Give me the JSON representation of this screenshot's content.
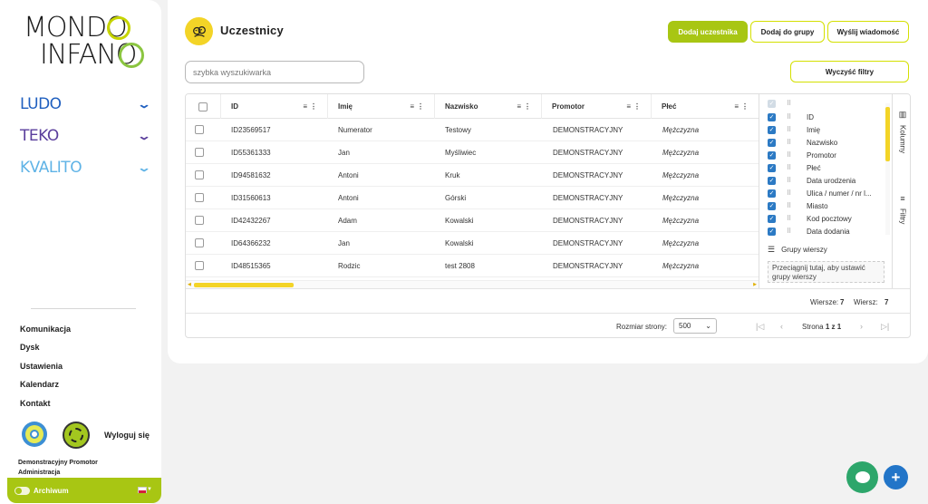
{
  "brand": {
    "line1": "MONDO",
    "line2": "INFANO"
  },
  "nav": [
    {
      "label": "LUDO",
      "color": "#1f5fbf"
    },
    {
      "label": "TEKO",
      "color": "#5a3e9c"
    },
    {
      "label": "KVALITO",
      "color": "#5fb3e6"
    }
  ],
  "menu": [
    "Komunikacja",
    "Dysk",
    "Ustawienia",
    "Kalendarz",
    "Kontakt"
  ],
  "user": {
    "logout": "Wyloguj się",
    "name": "Demonstracyjny Promotor",
    "role": "Administracja"
  },
  "archive": {
    "label": "Archiwum"
  },
  "page": {
    "title": "Uczestnicy"
  },
  "actions": {
    "add_participant": "Dodaj uczestnika",
    "add_to_group": "Dodaj do grupy",
    "send_message": "Wyślij wiadomość",
    "clear_filters": "Wyczyść filtry"
  },
  "search": {
    "placeholder": "szybka wyszukiwarka",
    "value": ""
  },
  "table": {
    "columns": [
      "ID",
      "Imię",
      "Nazwisko",
      "Promotor",
      "Płeć"
    ],
    "rows": [
      [
        "ID23569517",
        "Numerator",
        "Testowy",
        "DEMONSTRACYJNY",
        "Mężczyzna"
      ],
      [
        "ID55361333",
        "Jan",
        "Myśliwiec",
        "DEMONSTRACYJNY",
        "Mężczyzna"
      ],
      [
        "ID94581632",
        "Antoni",
        "Kruk",
        "DEMONSTRACYJNY",
        "Mężczyzna"
      ],
      [
        "ID31560613",
        "Antoni",
        "Górski",
        "DEMONSTRACYJNY",
        "Mężczyzna"
      ],
      [
        "ID42432267",
        "Adam",
        "Kowalski",
        "DEMONSTRACYJNY",
        "Mężczyzna"
      ],
      [
        "ID64366232",
        "Jan",
        "Kowalski",
        "DEMONSTRACYJNY",
        "Mężczyzna"
      ],
      [
        "ID48515365",
        "Rodzic",
        "test 2808",
        "DEMONSTRACYJNY",
        "Mężczyzna"
      ]
    ]
  },
  "column_panel": {
    "items": [
      "ID",
      "Imię",
      "Nazwisko",
      "Promotor",
      "Płeć",
      "Data urodzenia",
      "Ulica / numer / nr l...",
      "Miasto",
      "Kod pocztowy",
      "Data dodania"
    ],
    "row_groups": "Grupy wierszy",
    "drop_hint_1": "Przeciągnij tutaj, aby ustawić",
    "drop_hint_2": "grupy wierszy"
  },
  "side_tabs": {
    "columns": "Kolumny",
    "filters": "Filtry"
  },
  "status": {
    "rows_label": "Wiersze:",
    "rows_value": "7",
    "rows2_label": "Wiersz:",
    "rows2_value": "7"
  },
  "pager": {
    "size_label": "Rozmiar strony:",
    "size_value": "500",
    "page_text": "Strona",
    "page_cur": "1",
    "page_of": "z",
    "page_total": "1"
  },
  "colors": {
    "accent": "#a8c613",
    "yellow": "#f3d427",
    "blue": "#2275c8",
    "green": "#2da66b"
  }
}
